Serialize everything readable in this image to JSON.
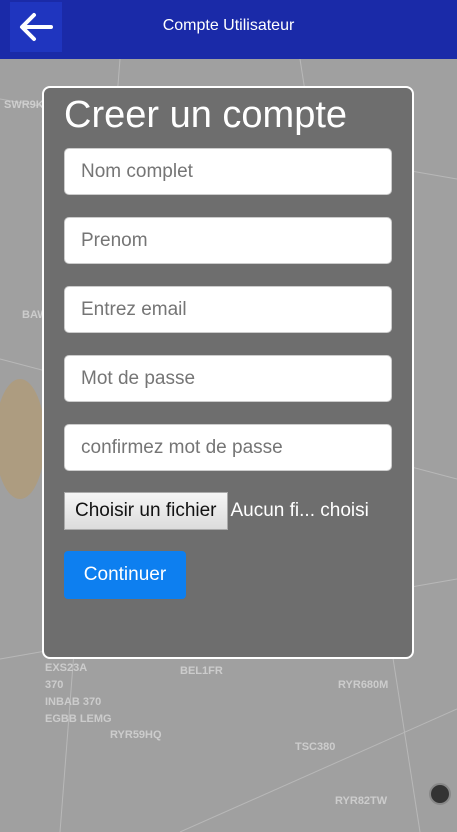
{
  "header": {
    "title": "Compte Utilisateur",
    "back_icon": "arrow-left-icon"
  },
  "form": {
    "heading": "Creer un compte",
    "fields": [
      {
        "placeholder": "Nom complet",
        "value": ""
      },
      {
        "placeholder": "Prenom",
        "value": ""
      },
      {
        "placeholder": "Entrez email",
        "value": ""
      },
      {
        "placeholder": "Mot de passe",
        "value": ""
      },
      {
        "placeholder": "confirmez mot de passe",
        "value": ""
      }
    ],
    "file_button": "Choisir un fichier",
    "file_status": "Aucun fi... choisi",
    "submit": "Continuer"
  },
  "map_labels": [
    "SWR9K",
    "BAW",
    "EXS23A",
    "370",
    "INBAB 370",
    "EGBB LEMG",
    "BEL1FR",
    "RYR680M",
    "TSC380",
    "RYR82TW",
    "RYR59HQ"
  ],
  "colors": {
    "header": "#1a2aa8",
    "accent": "#0d7ff0",
    "card": "#6e6e6e"
  }
}
